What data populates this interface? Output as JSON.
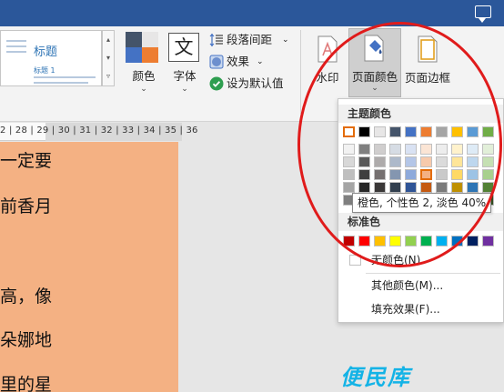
{
  "ribbon": {
    "style_title": "标题",
    "style_sub": "标题 1",
    "colors_label": "颜色",
    "fonts_label": "字体",
    "fonts_glyph": "文",
    "paragraph_spacing": "段落间距",
    "effects": "效果",
    "set_default": "设为默认值",
    "watermark": "水印",
    "page_color": "页面颜色",
    "page_borders": "页面边框"
  },
  "ruler": {
    "ticks": "2 | 28 | 29 | 30 | 31 | 32 | 33 | 34 | 35 | 36"
  },
  "document": {
    "lines": [
      "一定要",
      "前香月",
      "高，像",
      "朵娜地",
      "里的星"
    ]
  },
  "dropdown": {
    "theme_header": "主题颜色",
    "standard_header": "标准色",
    "tooltip": "橙色, 个性色 2, 淡色 40%",
    "no_color": "无颜色(N)",
    "more_colors": "其他颜色(M)...",
    "fill_effects": "填充效果(F)...",
    "theme_colors": [
      "#ffffff",
      "#000000",
      "#e7e6e6",
      "#44546a",
      "#4472c4",
      "#ed7d31",
      "#a5a5a5",
      "#ffc000",
      "#5b9bd5",
      "#70ad47"
    ],
    "theme_shades": [
      [
        "#f2f2f2",
        "#7f7f7f",
        "#d0cece",
        "#d6dce4",
        "#d9e2f3",
        "#fbe5d5",
        "#ededed",
        "#fff2cc",
        "#deebf6",
        "#e2efd9"
      ],
      [
        "#d8d8d8",
        "#595959",
        "#aeabab",
        "#adb9ca",
        "#b4c6e7",
        "#f7caac",
        "#dbdbdb",
        "#fee599",
        "#bdd7ee",
        "#c5e0b3"
      ],
      [
        "#bfbfbf",
        "#3f3f3f",
        "#757070",
        "#8496b0",
        "#8eaadb",
        "#f4b183",
        "#c9c9c9",
        "#ffd965",
        "#9cc3e5",
        "#a8d08d"
      ],
      [
        "#a5a5a5",
        "#262626",
        "#3a3838",
        "#323f4f",
        "#2f5496",
        "#c55a11",
        "#7b7b7b",
        "#bf9000",
        "#2e75b5",
        "#538135"
      ],
      [
        "#7f7f7f",
        "#0c0c0c",
        "#171616",
        "#222a35",
        "#1f3864",
        "#833c0b",
        "#525252",
        "#7f6000",
        "#1e4d78",
        "#375623"
      ]
    ],
    "standard_colors": [
      "#c00000",
      "#ff0000",
      "#ffc000",
      "#ffff00",
      "#92d050",
      "#00b050",
      "#00b0f0",
      "#0070c0",
      "#002060",
      "#7030a0"
    ]
  },
  "logo": "便民库"
}
